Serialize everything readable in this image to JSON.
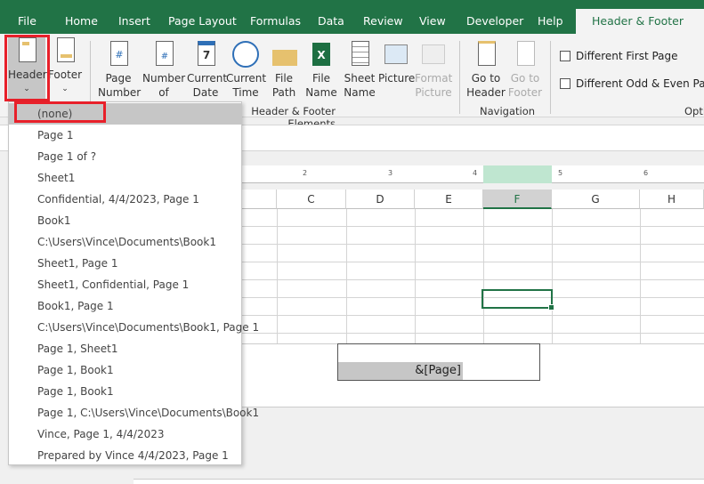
{
  "tabs": [
    "File",
    "Home",
    "Insert",
    "Page Layout",
    "Formulas",
    "Data",
    "Review",
    "View",
    "Developer",
    "Help",
    "Header & Footer"
  ],
  "ribbon": {
    "header": "Header",
    "footer": "Footer",
    "buttons": [
      [
        "Page",
        "Number"
      ],
      [
        "Number",
        "of Pages"
      ],
      [
        "Current",
        "Date"
      ],
      [
        "Current",
        "Time"
      ],
      [
        "File",
        "Path"
      ],
      [
        "File",
        "Name"
      ],
      [
        "Sheet",
        "Name"
      ],
      [
        "Picture",
        ""
      ],
      [
        "Format",
        "Picture"
      ],
      [
        "Go to",
        "Header"
      ],
      [
        "Go to",
        "Footer"
      ]
    ],
    "group_elements": "Header & Footer Elements",
    "group_navigation": "Navigation",
    "group_options": "Options",
    "different_first_page": "Different First Page",
    "different_odd_even": "Different Odd & Even Pages"
  },
  "ruler": [
    "2",
    "3",
    "4",
    "5",
    "6"
  ],
  "columns": [
    "C",
    "D",
    "E",
    "F",
    "G",
    "H"
  ],
  "footer_cell": "&[Page]",
  "dropdown": [
    "(none)",
    "Page 1",
    "Page 1 of ?",
    "Sheet1",
    " Confidential, 4/4/2023, Page 1",
    "Book1",
    "C:\\Users\\Vince\\Documents\\Book1",
    "Sheet1, Page 1",
    "Sheet1,  Confidential, Page 1",
    "Book1, Page 1",
    "C:\\Users\\Vince\\Documents\\Book1, Page 1",
    "Page 1, Sheet1",
    "Page 1, Book1",
    "Page 1, Book1",
    "Page 1, C:\\Users\\Vince\\Documents\\Book1",
    "Vince, Page 1, 4/4/2023",
    "Prepared by Vince 4/4/2023, Page 1"
  ],
  "colors": {
    "accent": "#217346",
    "highlight": "#e8202a"
  }
}
